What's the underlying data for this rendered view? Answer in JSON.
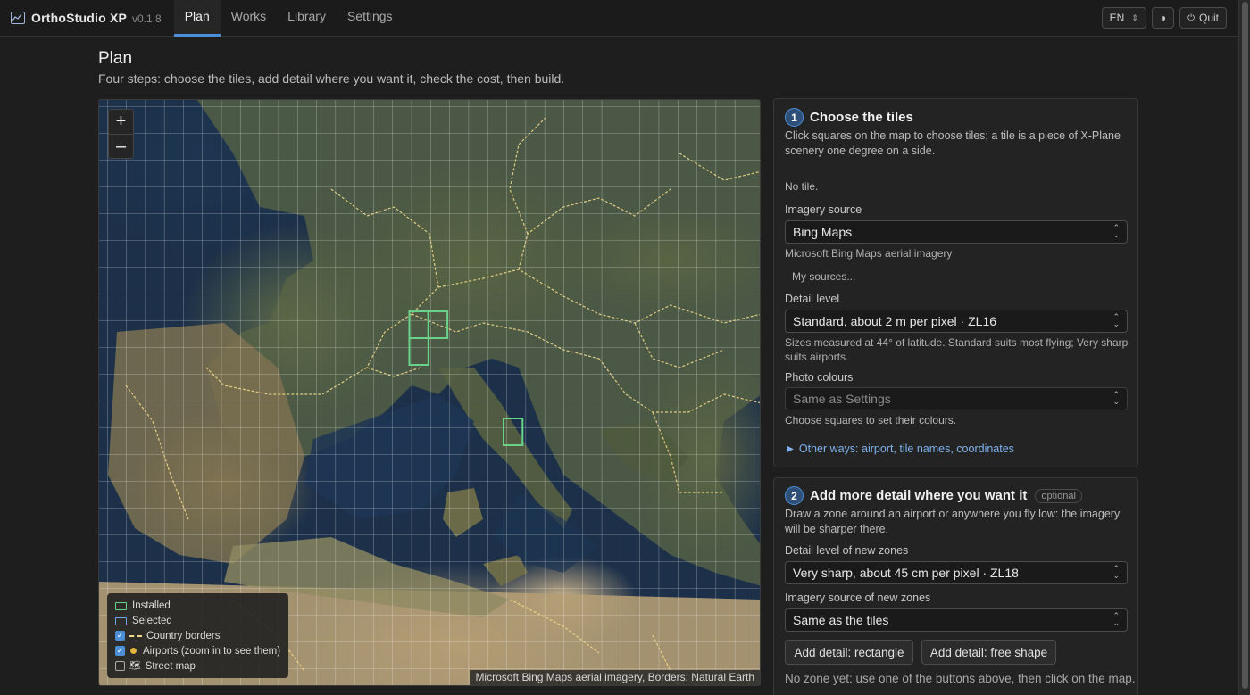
{
  "app": {
    "name": "OrthoStudio XP",
    "version": "v0.1.8"
  },
  "nav": {
    "tabs": [
      {
        "label": "Plan"
      },
      {
        "label": "Works"
      },
      {
        "label": "Library"
      },
      {
        "label": "Settings"
      }
    ],
    "active": "Plan"
  },
  "topright": {
    "language": "EN",
    "theme_icon": "contrast-icon",
    "quit_label": "Quit"
  },
  "page": {
    "title": "Plan",
    "subtitle": "Four steps: choose the tiles, add detail where you want it, check the cost, then build."
  },
  "map": {
    "zoom_in": "+",
    "zoom_out": "–",
    "legend": {
      "installed": "Installed",
      "selected": "Selected",
      "country_borders": "Country borders",
      "airports": "Airports (zoom in to see them)",
      "street_map": "Street map"
    },
    "layers": {
      "country_borders": true,
      "airports": true,
      "street_map": false
    },
    "attribution": "Microsoft Bing Maps aerial imagery, Borders: Natural Earth",
    "colors": {
      "installed": "#6ad38a",
      "selected": "#6fa6ea",
      "borders": "#f2d98a"
    }
  },
  "step1": {
    "number": "1",
    "title": "Choose the tiles",
    "desc": "Click squares on the map to choose tiles; a tile is a piece of X-Plane scenery one degree on a side.",
    "selection_status": "No tile.",
    "imagery_label": "Imagery source",
    "imagery_value": "Bing Maps",
    "imagery_hint": "Microsoft Bing Maps aerial imagery",
    "my_sources": "My sources...",
    "detail_label": "Detail level",
    "detail_value": "Standard, about 2 m per pixel · ZL16",
    "detail_hint": "Sizes measured at 44° of latitude. Standard suits most flying; Very sharp suits airports.",
    "colours_label": "Photo colours",
    "colours_value": "Same as Settings",
    "colours_hint": "Choose squares to set their colours.",
    "other_ways": "► Other ways: airport, tile names, coordinates"
  },
  "step2": {
    "number": "2",
    "title": "Add more detail where you want it",
    "badge": "optional",
    "desc": "Draw a zone around an airport or anywhere you fly low: the imagery will be sharper there.",
    "detail_label": "Detail level of new zones",
    "detail_value": "Very sharp, about 45 cm per pixel · ZL18",
    "imagery_label": "Imagery source of new zones",
    "imagery_value": "Same as the tiles",
    "btn_rect": "Add detail: rectangle",
    "btn_free": "Add detail: free shape",
    "status": "No zone yet: use one of the buttons above, then click on the map."
  }
}
